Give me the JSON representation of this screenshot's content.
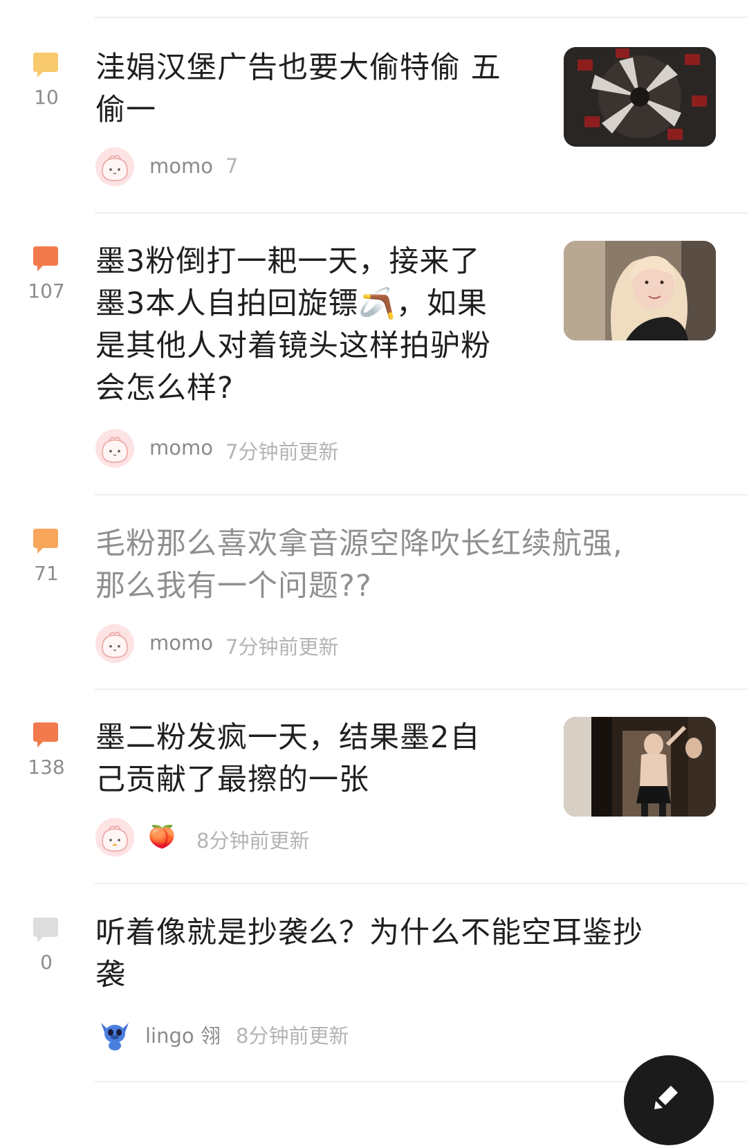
{
  "posts": [
    {
      "comment_count": "10",
      "bubble_color": "#F9C96E",
      "title_lines": [
        "洼娟汉堡广告也要大偷特偷 五",
        "偷一"
      ],
      "author": "momo",
      "time": "7",
      "has_thumbnail": true,
      "read": false
    },
    {
      "comment_count": "107",
      "bubble_color": "#F27B4E",
      "title_lines": [
        "墨3粉倒打一耙一天，接来了",
        "墨3本人自拍回旋镖🪃，如果",
        "是其他人对着镜头这样拍驴粉",
        "会怎么样?"
      ],
      "author": "momo",
      "time": "7分钟前更新",
      "has_thumbnail": true,
      "read": false
    },
    {
      "comment_count": "71",
      "bubble_color": "#F8A65C",
      "title_lines": [
        "毛粉那么喜欢拿音源空降吹长红续航强,",
        "那么我有一个问题??"
      ],
      "author": "momo",
      "time": "7分钟前更新",
      "has_thumbnail": false,
      "read": true
    },
    {
      "comment_count": "138",
      "bubble_color": "#F27B4E",
      "title_lines": [
        "墨二粉发疯一天，结果墨2自",
        "己贡献了最擦的一张"
      ],
      "author": "🍑",
      "time": "8分钟前更新",
      "has_thumbnail": true,
      "read": false
    },
    {
      "comment_count": "0",
      "bubble_color": "#DDDDDD",
      "title_lines": [
        "听着像就是抄袭么？为什么不能空耳鉴抄",
        "袭"
      ],
      "author": "lingo 翎",
      "time": "8分钟前更新",
      "has_thumbnail": false,
      "read": false
    }
  ],
  "icons": {
    "comment": "comment-bubble-icon",
    "fab": "pencil-icon",
    "avatar_default": "pink-blob-avatar",
    "avatar_lingo": "stitch-avatar"
  }
}
